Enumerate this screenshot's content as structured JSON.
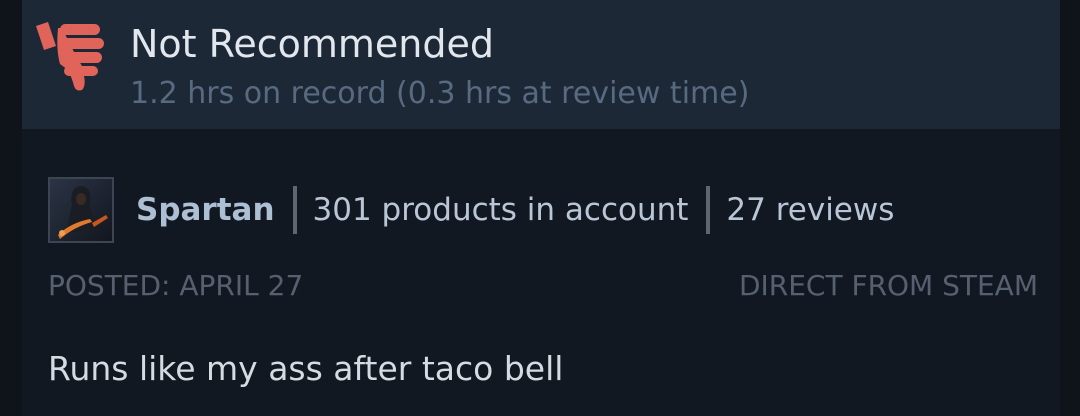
{
  "review": {
    "verdict": "Not Recommended",
    "verdict_icon": "thumbs-down-icon",
    "verdict_color": "#e0645a",
    "playtime": "1.2 hrs on record (0.3 hrs at review time)",
    "author": {
      "name": "Spartan",
      "products": "301 products in account",
      "reviews": "27 reviews"
    },
    "posted": "POSTED: APRIL 27",
    "source": "DIRECT FROM STEAM",
    "text": "Runs like my ass after taco bell"
  }
}
